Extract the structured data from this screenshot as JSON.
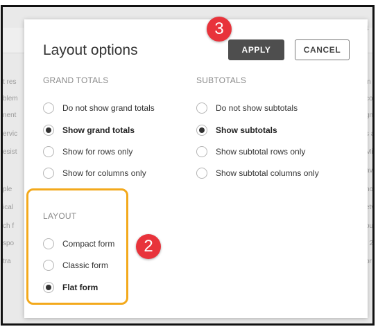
{
  "dialog": {
    "title": "Layout options",
    "apply_label": "APPLY",
    "cancel_label": "CANCEL"
  },
  "grand_totals": {
    "label": "GRAND TOTALS",
    "options": [
      {
        "label": "Do not show grand totals",
        "selected": false
      },
      {
        "label": "Show grand totals",
        "selected": true
      },
      {
        "label": "Show for rows only",
        "selected": false
      },
      {
        "label": "Show for columns only",
        "selected": false
      }
    ]
  },
  "subtotals": {
    "label": "SUBTOTALS",
    "options": [
      {
        "label": "Do not show subtotals",
        "selected": false
      },
      {
        "label": "Show subtotals",
        "selected": true
      },
      {
        "label": "Show subtotal rows only",
        "selected": false
      },
      {
        "label": "Show subtotal columns only",
        "selected": false
      }
    ]
  },
  "layout": {
    "label": "LAYOUT",
    "options": [
      {
        "label": "Compact form",
        "selected": false
      },
      {
        "label": "Classic form",
        "selected": false
      },
      {
        "label": "Flat form",
        "selected": true
      }
    ]
  },
  "annotations": {
    "step_apply": "3",
    "step_layout": "2",
    "badge_color": "#e8333b",
    "highlight_color": "#f3a91c"
  },
  "background_text": {
    "left": [
      "t res",
      "blem",
      "nent",
      "ervic",
      "esist",
      "ple",
      "ical",
      "ch f",
      "spo",
      "tra"
    ],
    "right": [
      "in 8",
      "co",
      "gn",
      "s an",
      "Mi",
      "ave",
      "nov",
      "etv",
      "ou",
      "f 2",
      "pr"
    ],
    "top_right": "4"
  }
}
